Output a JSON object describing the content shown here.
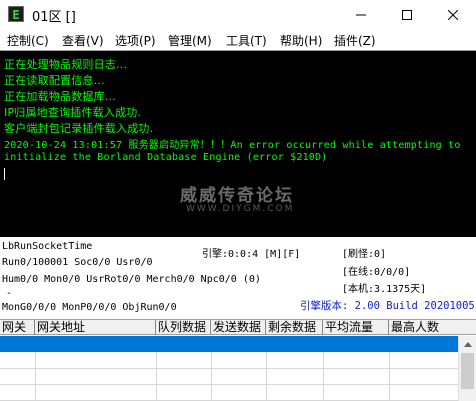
{
  "window": {
    "title": "01区 []",
    "app_icon_letter": "E"
  },
  "menu": [
    {
      "label": "控制(C)"
    },
    {
      "label": "查看(V)"
    },
    {
      "label": "选项(P)"
    },
    {
      "label": "管理(M)"
    },
    {
      "label": "工具(T)"
    },
    {
      "label": "帮助(H)"
    },
    {
      "label": "插件(Z)"
    }
  ],
  "console": {
    "lines": [
      "正在处理物品规则日志...",
      "正在读取配置信息...",
      "正在加载物品数据库...",
      "IP归属地查询插件载入成功.",
      "客户端封包记录插件载入成功.",
      "2020-10-24 13:01:57 服务器启动异常！！！An error occurred while attempting to",
      "initialize the Borland Database Engine (error $210D)"
    ],
    "text_color": "#00ff00"
  },
  "watermark": {
    "title": "威威传奇论坛",
    "url": "WWW.DIYGM.COM"
  },
  "status": {
    "socket_time": "LbRunSocketTime",
    "engine_counter": "引擎:0:0:4 [M][F]",
    "brush_monster": "[刷怪:0]",
    "run_line": "Run0/100001 Soc0/0 Usr0/0",
    "online": "[在线:0/0/0]",
    "hum_line": "Hum0/0 Mon0/0 UsrRot0/0 Merch0/0 Npc0/0 (0)",
    "local": "[本机:3.1375天]",
    "dash": "-",
    "mon_line": "MonG0/0/0 MonP0/0/0 ObjRun0/0",
    "engine_version": "引擎版本: 2.00 Build 20201005",
    "version_color": "#1020d0"
  },
  "grid": {
    "columns": [
      "网关",
      "网关地址",
      "队列数据",
      "发送数据",
      "剩余数据",
      "平均流量",
      "最高人数"
    ],
    "selection_color": "#0078d7"
  }
}
